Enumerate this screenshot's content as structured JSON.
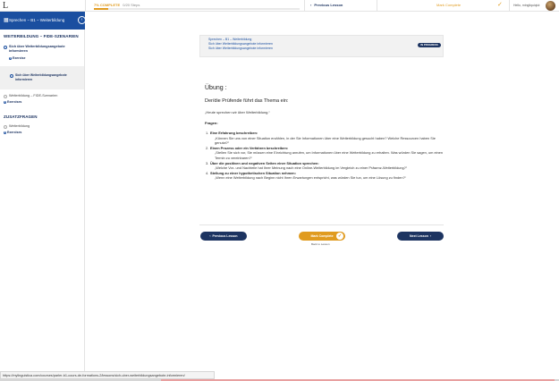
{
  "topbar": {
    "logo": "L",
    "progress_label": "7% COMPLETE",
    "progress_steps": "0/20 Steps",
    "progress_fraction": 0.07,
    "prev_label": "Previous Lesson",
    "mark_label": "Mark Complete",
    "hello": "Hello, mingliquiqiut"
  },
  "sidebar": {
    "course_title": "Sprechen – B1 – Weiterbildung",
    "sections": [
      {
        "title": "WEITERBILDUNG – FIDE-SZENARIEN",
        "lessons": [
          {
            "label": "Sich über Weiterbildungsangebote informieren",
            "badge": "Exercise",
            "badge_count": "1"
          },
          {
            "label": "Weiterbildung – FIDE-Szenarien",
            "badge": "Exercises",
            "badge_count": "4"
          }
        ]
      },
      {
        "title": "ZUSATZFRAGEN",
        "lessons": [
          {
            "label": "Weiterbildung",
            "badge": "Exercises",
            "badge_count": "4"
          }
        ]
      }
    ],
    "active_sub_lesson": "Sich über Weiterbildungsangebote informieren"
  },
  "breadcrumbs": {
    "lines": [
      "Sprechen – B1 – Weiterbildung",
      "Sich über Weiterbildungsangebote informieren",
      "Sich über Weiterbildungsangebote informieren"
    ],
    "status_pill": "IN PROGRESS"
  },
  "content": {
    "heading": "Übung :",
    "subheading": "Der/die Prüfende führt das Thema ein:",
    "intro_quote": "„Heute sprechen wir über Weiterbildung.“",
    "questions_label": "Fragen:",
    "questions": [
      {
        "num": "1.",
        "q": "Eine Erfahrung beschreiben:",
        "a": "„Können Sie uns von einer Situation erzählen, in der Sie Informationen über eine Weiterbildung gesucht haben? Welche Ressourcen haben Sie genutzt?“"
      },
      {
        "num": "2.",
        "q": "Einen Prozess oder ein Verfahren beschreiben:",
        "a": "„Stellen Sie sich vor, Sie müssen eine Einrichtung anrufen, um Informationen über eine Weiterbildung zu erhalten. Was würden Sie sagen, um einen Termin zu vereinbaren?“"
      },
      {
        "num": "3.",
        "q": "Über die positiven und negativen Seiten einer Situation sprechen:",
        "a": "„Welche Vor- und Nachteile hat Ihrer Meinung nach eine Online-Weiterbildung im Vergleich zu einer Präsenz-Weiterbildung?“"
      },
      {
        "num": "4.",
        "q": "Stellung zu einer hypothetischen Situation nehmen:",
        "a": "„Wenn eine Weiterbildung nach Beginn nicht Ihren Erwartungen entspricht, was würden Sie tun, um eine Lösung zu finden?“"
      }
    ]
  },
  "nav": {
    "prev": "Previous Lesson",
    "mark": "Mark Complete",
    "back": "Back to Lesson",
    "next": "Next Lesson"
  },
  "statusbar": {
    "url": "https://mylinguistica.com/courses/parler-b1-cours-de-formations-2/lessons/sich-uber-weiterbildungsangebote-informieren/"
  },
  "colors": {
    "brand_blue": "#1b4fa0",
    "navy": "#1d3461",
    "accent_orange": "#e09b1f"
  }
}
